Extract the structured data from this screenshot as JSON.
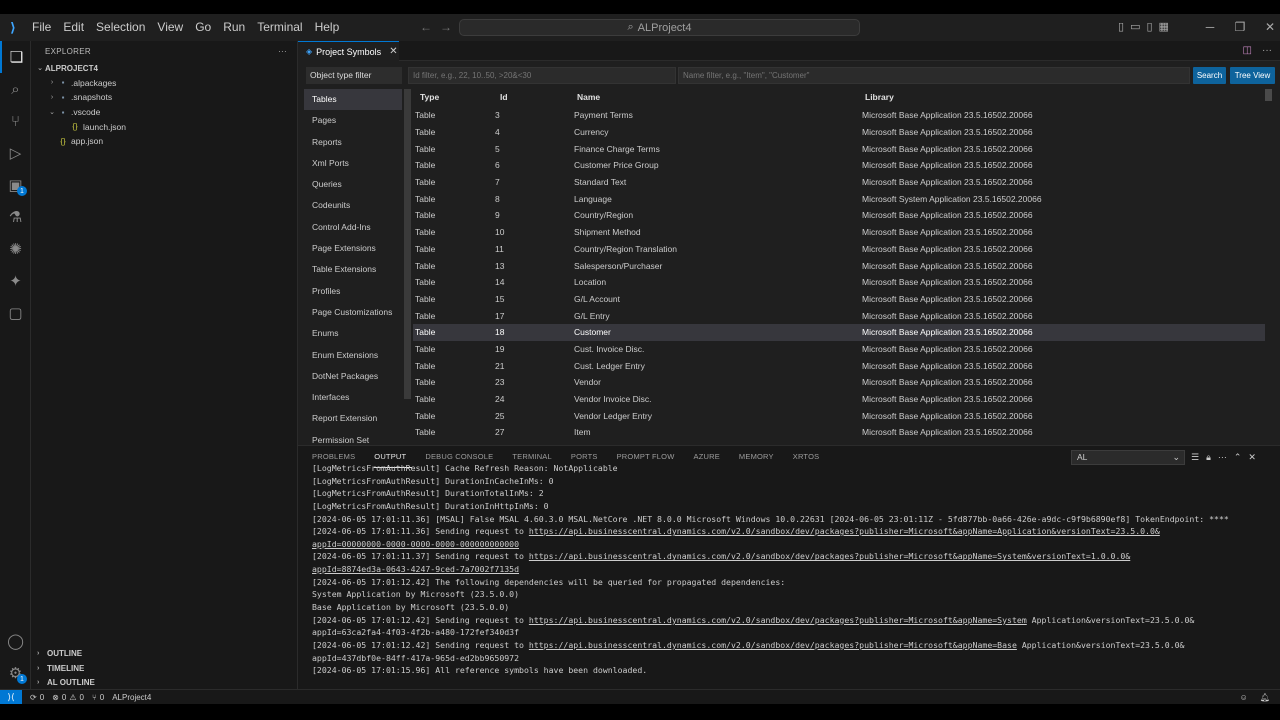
{
  "menu": [
    "File",
    "Edit",
    "Selection",
    "View",
    "Go",
    "Run",
    "Terminal",
    "Help"
  ],
  "command_center": {
    "label": "ALProject4"
  },
  "activity": {
    "extensions_badge": "1",
    "settings_badge": "1"
  },
  "explorer": {
    "title": "EXPLORER",
    "more": "···",
    "root": "ALPROJECT4",
    "items": [
      {
        "label": ".alpackages",
        "indent": 1,
        "twisty": "›",
        "icon": "▪"
      },
      {
        "label": ".snapshots",
        "indent": 1,
        "twisty": "›",
        "icon": "▪"
      },
      {
        "label": ".vscode",
        "indent": 1,
        "twisty": "⌄",
        "icon": "▪"
      },
      {
        "label": "launch.json",
        "indent": 2,
        "twisty": "",
        "icon": "{}"
      },
      {
        "label": "app.json",
        "indent": 1,
        "twisty": "",
        "icon": "{}"
      }
    ],
    "sections": [
      "OUTLINE",
      "TIMELINE",
      "AL OUTLINE"
    ]
  },
  "editor_tab": {
    "label": "Project Symbols",
    "close": "✕"
  },
  "symbols": {
    "object_type_filter": "Object type filter",
    "id_filter_placeholder": "Id filter, e.g., 22, 10..50, >20&<30",
    "name_filter_placeholder": "Name filter, e.g., \"Item\", \"Customer\"",
    "search_label": "Search",
    "tree_view_label": "Tree View",
    "object_types": [
      "Tables",
      "Pages",
      "Reports",
      "Xml Ports",
      "Queries",
      "Codeunits",
      "Control Add-Ins",
      "Page Extensions",
      "Table Extensions",
      "Profiles",
      "Page Customizations",
      "Enums",
      "Enum Extensions",
      "DotNet Packages",
      "Interfaces",
      "Report Extension",
      "Permission Set"
    ],
    "columns": [
      "Type",
      "Id",
      "Name",
      "Library"
    ],
    "rows": [
      [
        "Table",
        "3",
        "Payment Terms",
        "Microsoft Base Application 23.5.16502.20066"
      ],
      [
        "Table",
        "4",
        "Currency",
        "Microsoft Base Application 23.5.16502.20066"
      ],
      [
        "Table",
        "5",
        "Finance Charge Terms",
        "Microsoft Base Application 23.5.16502.20066"
      ],
      [
        "Table",
        "6",
        "Customer Price Group",
        "Microsoft Base Application 23.5.16502.20066"
      ],
      [
        "Table",
        "7",
        "Standard Text",
        "Microsoft Base Application 23.5.16502.20066"
      ],
      [
        "Table",
        "8",
        "Language",
        "Microsoft System Application 23.5.16502.20066"
      ],
      [
        "Table",
        "9",
        "Country/Region",
        "Microsoft Base Application 23.5.16502.20066"
      ],
      [
        "Table",
        "10",
        "Shipment Method",
        "Microsoft Base Application 23.5.16502.20066"
      ],
      [
        "Table",
        "11",
        "Country/Region Translation",
        "Microsoft Base Application 23.5.16502.20066"
      ],
      [
        "Table",
        "13",
        "Salesperson/Purchaser",
        "Microsoft Base Application 23.5.16502.20066"
      ],
      [
        "Table",
        "14",
        "Location",
        "Microsoft Base Application 23.5.16502.20066"
      ],
      [
        "Table",
        "15",
        "G/L Account",
        "Microsoft Base Application 23.5.16502.20066"
      ],
      [
        "Table",
        "17",
        "G/L Entry",
        "Microsoft Base Application 23.5.16502.20066"
      ],
      [
        "Table",
        "18",
        "Customer",
        "Microsoft Base Application 23.5.16502.20066"
      ],
      [
        "Table",
        "19",
        "Cust. Invoice Disc.",
        "Microsoft Base Application 23.5.16502.20066"
      ],
      [
        "Table",
        "21",
        "Cust. Ledger Entry",
        "Microsoft Base Application 23.5.16502.20066"
      ],
      [
        "Table",
        "23",
        "Vendor",
        "Microsoft Base Application 23.5.16502.20066"
      ],
      [
        "Table",
        "24",
        "Vendor Invoice Disc.",
        "Microsoft Base Application 23.5.16502.20066"
      ],
      [
        "Table",
        "25",
        "Vendor Ledger Entry",
        "Microsoft Base Application 23.5.16502.20066"
      ],
      [
        "Table",
        "27",
        "Item",
        "Microsoft Base Application 23.5.16502.20066"
      ]
    ],
    "selected_row": 13
  },
  "panel": {
    "tabs": [
      "PROBLEMS",
      "OUTPUT",
      "DEBUG CONSOLE",
      "TERMINAL",
      "PORTS",
      "PROMPT FLOW",
      "AZURE",
      "MEMORY",
      "XRTOS"
    ],
    "active_tab": 1,
    "channel": "AL",
    "log": [
      {
        "text": "[LogMetricsFromAuthResult] Cache Refresh Reason: NotApplicable"
      },
      {
        "text": "[LogMetricsFromAuthResult] DurationInCacheInMs: 0"
      },
      {
        "text": "[LogMetricsFromAuthResult] DurationTotalInMs: 2"
      },
      {
        "text": "[LogMetricsFromAuthResult] DurationInHttpInMs: 0"
      },
      {
        "text": "[2024-06-05 17:01:11.36] [MSAL] False MSAL 4.60.3.0 MSAL.NetCore .NET 8.0.0 Microsoft Windows 10.0.22631 [2024-06-05 23:01:11Z - 5fd877bb-0a66-426e-a9dc-c9f9b6890ef8] TokenEndpoint: ****"
      },
      {
        "text": "[2024-06-05 17:01:11.36] Sending request to ",
        "link": "https://api.businesscentral.dynamics.com/v2.0/sandbox/dev/packages?publisher=Microsoft&appName=Application&versionText=23.5.0.0&"
      },
      {
        "text": "",
        "link": "appId=00000000-0000-0000-0000-000000000000"
      },
      {
        "text": "[2024-06-05 17:01:11.37] Sending request to ",
        "link": "https://api.businesscentral.dynamics.com/v2.0/sandbox/dev/packages?publisher=Microsoft&appName=System&versionText=1.0.0.0&"
      },
      {
        "text": "",
        "link": "appId=8874ed3a-0643-4247-9ced-7a7002f7135d"
      },
      {
        "text": "[2024-06-05 17:01:12.42] The following dependencies will be queried for propagated dependencies:"
      },
      {
        "text": "System Application by Microsoft (23.5.0.0)"
      },
      {
        "text": "Base Application by Microsoft (23.5.0.0)"
      },
      {
        "text": "[2024-06-05 17:01:12.42] Sending request to ",
        "link": "https://api.businesscentral.dynamics.com/v2.0/sandbox/dev/packages?publisher=Microsoft&appName=System",
        "tail": " Application&versionText=23.5.0.0&"
      },
      {
        "text": "appId=63ca2fa4-4f03-4f2b-a480-172fef340d3f"
      },
      {
        "text": "[2024-06-05 17:01:12.42] Sending request to ",
        "link": "https://api.businesscentral.dynamics.com/v2.0/sandbox/dev/packages?publisher=Microsoft&appName=Base",
        "tail": " Application&versionText=23.5.0.0&"
      },
      {
        "text": "appId=437dbf0e-84ff-417a-965d-ed2bb9650972"
      },
      {
        "text": "[2024-06-05 17:01:15.96] All reference symbols have been downloaded."
      }
    ]
  },
  "status": {
    "sync": "0",
    "errors": "0",
    "warnings": "0",
    "ports": "0",
    "project": "ALProject4"
  }
}
